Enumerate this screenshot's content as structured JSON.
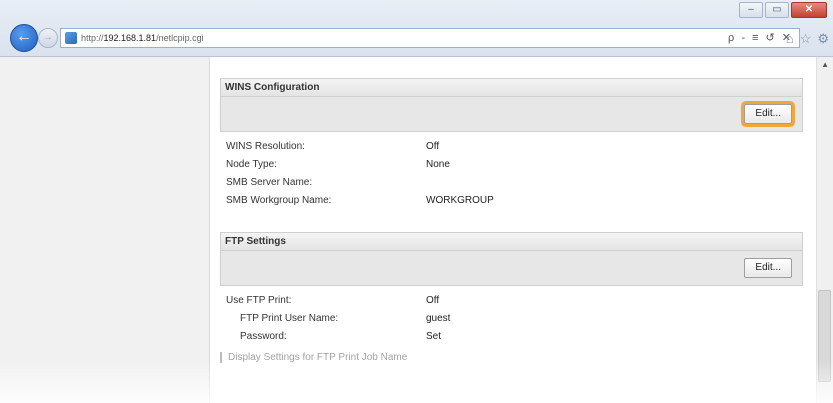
{
  "browser": {
    "url_prefix": "http://",
    "url_host": "192.168.1.81",
    "url_path": "/netlcpip.cgi",
    "address_tools": "ρ - ≡ ↺ ✕",
    "window_controls": {
      "minimize": "–",
      "maximize": "▭",
      "close": "✕"
    }
  },
  "sections": [
    {
      "title": "WINS Configuration",
      "edit_label": "Edit...",
      "rows": [
        {
          "label": "WINS Resolution:",
          "value": "Off"
        },
        {
          "label": "Node Type:",
          "value": "None"
        },
        {
          "label": "SMB Server Name:",
          "value": ""
        },
        {
          "label": "SMB Workgroup Name:",
          "value": "WORKGROUP"
        }
      ]
    },
    {
      "title": "FTP Settings",
      "edit_label": "Edit...",
      "rows": [
        {
          "label": "Use FTP Print:",
          "value": "Off"
        },
        {
          "label": "FTP Print User Name:",
          "value": "guest"
        },
        {
          "label": "Password:",
          "value": "Set"
        }
      ],
      "footer_link": "Display Settings for FTP Print Job Name"
    }
  ],
  "colors": {
    "highlight": "#f2a73a",
    "accent": "#1d5fbf"
  }
}
